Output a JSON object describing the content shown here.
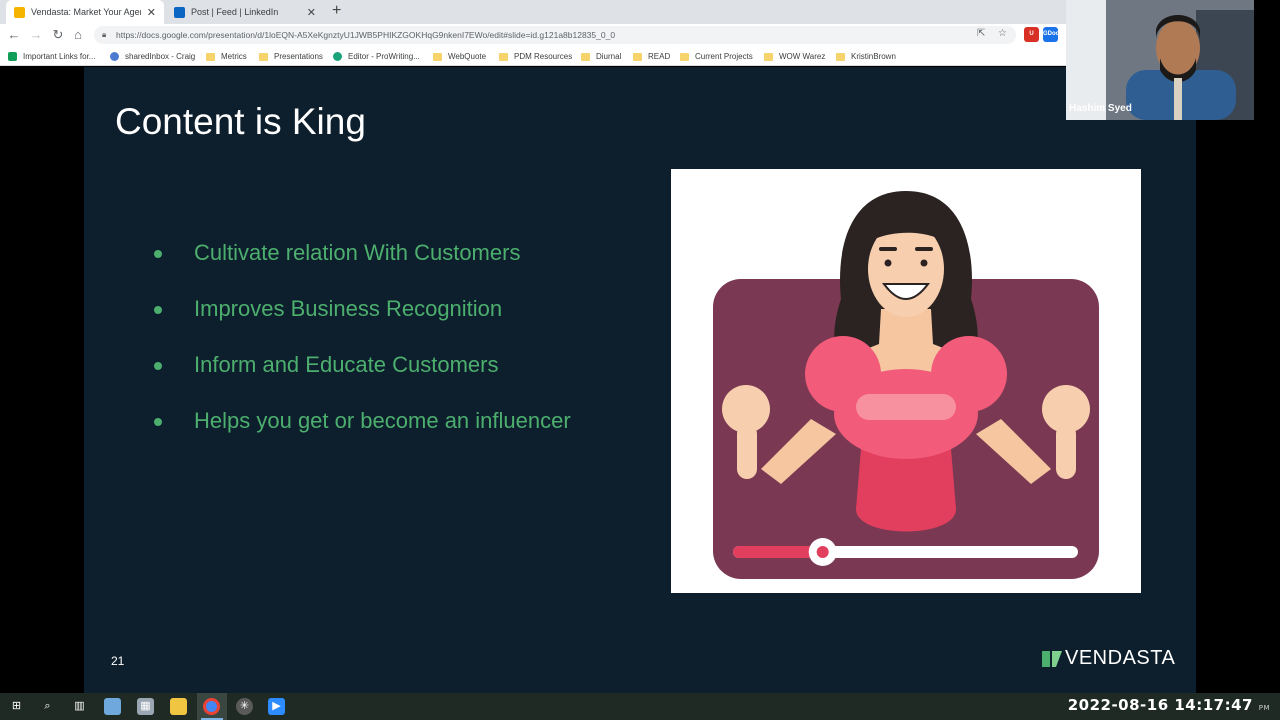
{
  "browser": {
    "tabs": [
      {
        "title": "Vendasta: Market Your Agency -",
        "favicon": "slides-icon",
        "active": true
      },
      {
        "title": "Post | Feed | LinkedIn",
        "favicon": "linkedin-icon",
        "active": false
      }
    ],
    "url": "https://docs.google.com/presentation/d/1loEQN-A5XeKgnztyU1JWB5PHIKZGOKHqG9nkenI7EWo/edit#slide=id.g121a8b12835_0_0",
    "bookmarks": [
      {
        "label": "Important Links for...",
        "icon": "sheets-icon"
      },
      {
        "label": "sharedInbox - Craig",
        "icon": "people-icon"
      },
      {
        "label": "Metrics",
        "icon": "folder-icon"
      },
      {
        "label": "Presentations",
        "icon": "folder-icon"
      },
      {
        "label": "Editor - ProWriting...",
        "icon": "prowriting-icon"
      },
      {
        "label": "WebQuote",
        "icon": "folder-icon"
      },
      {
        "label": "PDM Resources",
        "icon": "folder-icon"
      },
      {
        "label": "Diurnal",
        "icon": "folder-icon"
      },
      {
        "label": "READ",
        "icon": "folder-icon"
      },
      {
        "label": "Current Projects",
        "icon": "folder-icon"
      },
      {
        "label": "WOW Warez",
        "icon": "folder-icon"
      },
      {
        "label": "KristinBrown",
        "icon": "folder-icon"
      }
    ],
    "extensions": [
      "U",
      "GDoc"
    ]
  },
  "slide": {
    "title": "Content is King",
    "bullets": [
      "Cultivate relation With Customers",
      "Improves Business Recognition",
      "Inform and Educate Customers",
      "Helps you get or become an influencer"
    ],
    "page_number": "21",
    "logo_text": "VENDASTA",
    "video_progress": 0.26
  },
  "webcam": {
    "name": "Hashim Syed"
  },
  "taskbar": {
    "clock": "2022-08-16  14:17:47",
    "clock_suffix": "PM"
  },
  "colors": {
    "slide_bg": "#0d1e2c",
    "bullet_green": "#4caf6e",
    "video_frame": "#7a3852",
    "accent_pink": "#f25b7a"
  }
}
